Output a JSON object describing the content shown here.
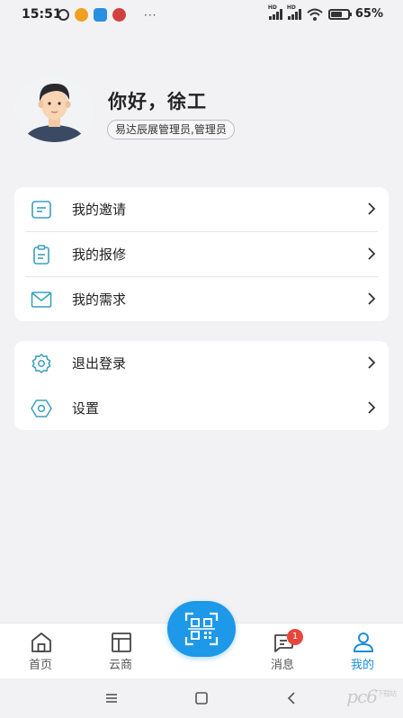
{
  "status_bar": {
    "time": "15:51",
    "more": "···",
    "sim1_label": "HD",
    "sim2_label": "HD",
    "battery_text": "65%",
    "battery_level": 0.65
  },
  "profile": {
    "greeting": "你好，徐工",
    "role": "易达辰展管理员,管理员"
  },
  "menu_group_1": [
    {
      "label": "我的邀请",
      "icon": "invitation-icon"
    },
    {
      "label": "我的报修",
      "icon": "repair-clipboard-icon"
    },
    {
      "label": "我的需求",
      "icon": "envelope-icon"
    }
  ],
  "menu_group_2": [
    {
      "label": "退出登录",
      "icon": "logout-gear-icon"
    },
    {
      "label": "设置",
      "icon": "settings-icon"
    }
  ],
  "tab_bar": {
    "tabs": [
      {
        "label": "首页",
        "icon": "home-icon",
        "active": false
      },
      {
        "label": "云商",
        "icon": "layout-icon",
        "active": false
      },
      {
        "label": "消息",
        "icon": "message-icon",
        "active": false,
        "badge": "1"
      },
      {
        "label": "我的",
        "icon": "user-icon",
        "active": true
      }
    ],
    "scan_icon": "qr-scan-icon"
  },
  "colors": {
    "accent": "#1e98e8",
    "active_tab": "#1a8ed8",
    "icon_teal": "#3a9fc0",
    "badge": "#e9463a",
    "background": "#f2f2f4"
  },
  "watermark": {
    "text": "pc6",
    "sub": "下载站"
  }
}
